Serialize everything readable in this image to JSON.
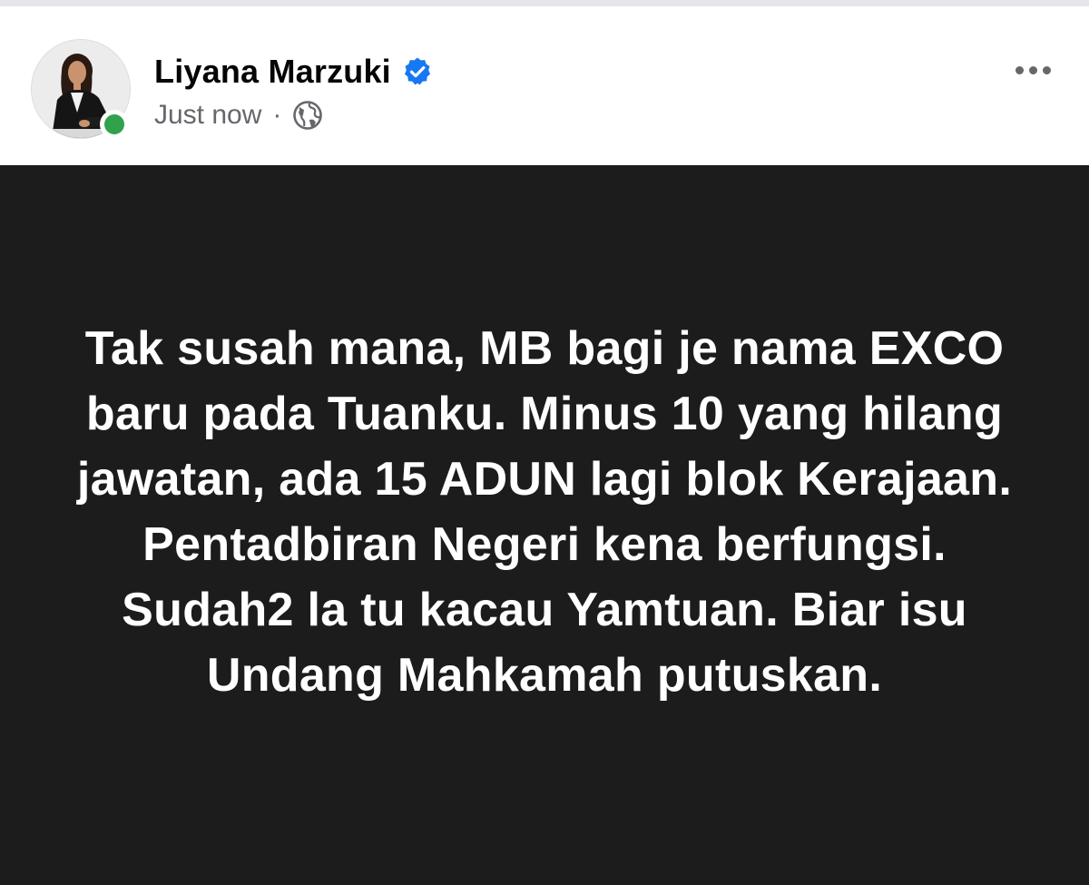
{
  "post": {
    "author_name": "Liyana Marzuki",
    "timestamp": "Just now",
    "separator": "·",
    "audience_icon": "globe-icon",
    "verified_icon": "verified-badge-icon",
    "more_icon": "more-options-icon",
    "text": "Tak susah mana, MB bagi je nama EXCO baru pada Tuanku. Minus 10 yang hilang jawatan, ada 15 ADUN lagi blok Kerajaan. Pentadbiran Negeri kena berfungsi. Sudah2 la tu kacau Yamtuan. Biar isu Undang Mahkamah putuskan.",
    "background_color": "#1c1c1c",
    "text_color": "#ffffff"
  },
  "colors": {
    "verified_blue": "#1877f2",
    "online_green": "#31a24c",
    "secondary_text": "#65676b"
  }
}
